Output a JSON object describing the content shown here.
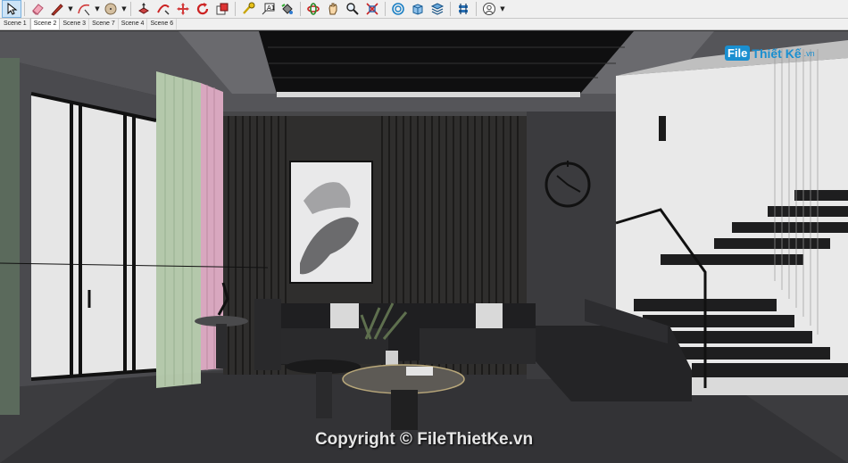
{
  "toolbar": {
    "tools": [
      {
        "name": "select-icon",
        "dropdown": false
      },
      {
        "name": "eraser-icon",
        "dropdown": false
      },
      {
        "name": "pencil-line-icon",
        "dropdown": true
      },
      {
        "name": "arc-icon",
        "dropdown": true
      },
      {
        "name": "shape-circle-icon",
        "dropdown": true
      },
      {
        "name": "push-pull-icon",
        "dropdown": false
      },
      {
        "name": "follow-me-icon",
        "dropdown": false
      },
      {
        "name": "move-icon",
        "dropdown": false
      },
      {
        "name": "rotate-icon",
        "dropdown": false
      },
      {
        "name": "scale-icon",
        "dropdown": false
      },
      {
        "name": "tape-measure-icon",
        "dropdown": false
      },
      {
        "name": "text-icon",
        "dropdown": false
      },
      {
        "name": "paint-bucket-icon",
        "dropdown": false
      },
      {
        "name": "orbit-icon",
        "dropdown": false
      },
      {
        "name": "pan-icon",
        "dropdown": false
      },
      {
        "name": "zoom-icon",
        "dropdown": false
      },
      {
        "name": "zoom-extents-icon",
        "dropdown": false
      },
      {
        "name": "warehouse-icon",
        "dropdown": false
      },
      {
        "name": "extension-warehouse-icon",
        "dropdown": false
      },
      {
        "name": "layers-icon",
        "dropdown": false
      },
      {
        "name": "extension-manager-icon",
        "dropdown": false
      },
      {
        "name": "account-icon",
        "dropdown": true
      }
    ]
  },
  "scene_tabs": [
    "Scene 1",
    "Scene 2",
    "Scene 3",
    "Scene 7",
    "Scene 4",
    "Scene 6"
  ],
  "active_scene": "Scene 2",
  "logo": {
    "file": "File",
    "rest": "Thiết Kế",
    "domain": ".vn"
  },
  "copyright": "Copyright © FileThietKe.vn",
  "colors": {
    "accent": "#1a8fd0",
    "curtain_green": "#b9cfb0",
    "curtain_pink": "#d8a7bf"
  }
}
